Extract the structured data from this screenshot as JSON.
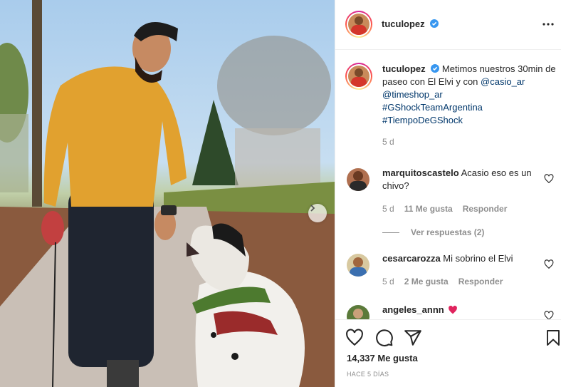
{
  "post": {
    "username": "tuculopez",
    "verified": true,
    "caption_text": "Metimos nuestros 30min de paseo con El Elvi y con",
    "caption_mentions": [
      "@casio_ar",
      "@timeshop_ar"
    ],
    "caption_hashtags": [
      "#GShockTeamArgentina",
      "#TiempoDeGShock"
    ],
    "caption_age": "5 d",
    "likes": "14,337 Me gusta",
    "posted_ago": "HACE 5 DÍAS"
  },
  "comments": [
    {
      "username": "marquitoscastelo",
      "text": "Acasio eso es un chivo?",
      "age": "5 d",
      "likes": "11 Me gusta",
      "reply_label": "Responder",
      "view_replies": "Ver respuestas (2)"
    },
    {
      "username": "cesarcarozza",
      "text": "Mi sobrino el Elvi",
      "age": "5 d",
      "likes": "2 Me gusta",
      "reply_label": "Responder"
    },
    {
      "username": "angeles_annn",
      "text": ""
    }
  ],
  "icons": {
    "verified": "verified-badge-icon",
    "more": "more-options-icon",
    "like": "heart-icon",
    "comment": "comment-icon",
    "share": "paper-plane-icon",
    "save": "bookmark-icon",
    "next": "chevron-right-icon",
    "emoji": "heart-emoji-icon"
  },
  "colors": {
    "verified_blue": "#3897f0",
    "link": "#00376b",
    "secondary_text": "#8e8e8e",
    "emoji_red": "#e0245e"
  }
}
